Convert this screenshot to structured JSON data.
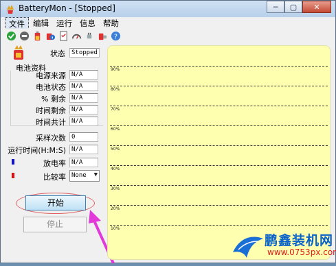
{
  "window": {
    "title": "BatteryMon - [Stopped]",
    "controls": [
      "─",
      "▢",
      "✕"
    ]
  },
  "menu": [
    "文件",
    "编辑",
    "运行",
    "信息",
    "帮助"
  ],
  "toolbar": {
    "icons": [
      "green-check-icon",
      "stop-icon",
      "battery-icon",
      "battery-info-icon",
      "document-icon",
      "gauge-icon",
      "plug-icon",
      "battery-plug-icon",
      "help-icon"
    ]
  },
  "status": {
    "label": "状态",
    "value": "Stopped"
  },
  "battery_info": {
    "title": "电池资料",
    "fields": [
      {
        "label": "电源来源",
        "value": "N/A"
      },
      {
        "label": "电池状态",
        "value": "N/A"
      },
      {
        "label": "% 剩余",
        "value": "N/A"
      },
      {
        "label": "时间剩余",
        "value": "N/A"
      },
      {
        "label": "时间共计",
        "value": "N/A"
      }
    ]
  },
  "samples": {
    "label": "采样次数",
    "value": "0"
  },
  "runtime": {
    "label": "运行时间(H:M:S)",
    "value": "N/A"
  },
  "discharge": {
    "label": "放电率",
    "value": "N/A",
    "color": "#1010d0"
  },
  "compare": {
    "label": "比较率",
    "value": "None",
    "color": "#e01010"
  },
  "buttons": {
    "start": "开始",
    "stop": "停止"
  },
  "chart": {
    "background": "#ffffb0",
    "gridlines": [
      "90%",
      "80%",
      "70%",
      "60%",
      "50%",
      "40%",
      "30%",
      "20%",
      "10%"
    ]
  },
  "watermark": {
    "name": "鹏鑫装机网",
    "url": "www.0753px.com"
  }
}
